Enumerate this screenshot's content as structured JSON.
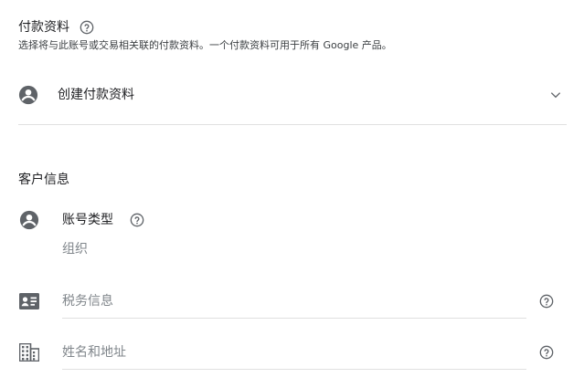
{
  "payment_profile": {
    "title": "付款资料",
    "description": "选择将与此账号或交易相关联的付款资料。一个付款资料可用于所有 Google 产品。",
    "create_label": "创建付款资料"
  },
  "customer_info": {
    "title": "客户信息",
    "account_type": {
      "label": "账号类型",
      "value": "组织"
    },
    "tax_info": {
      "placeholder": "税务信息"
    },
    "name_address": {
      "placeholder": "姓名和地址"
    }
  },
  "colors": {
    "icon": "#5f6368",
    "text": "#202124",
    "muted": "#80868b",
    "divider": "#e0e0e0"
  }
}
